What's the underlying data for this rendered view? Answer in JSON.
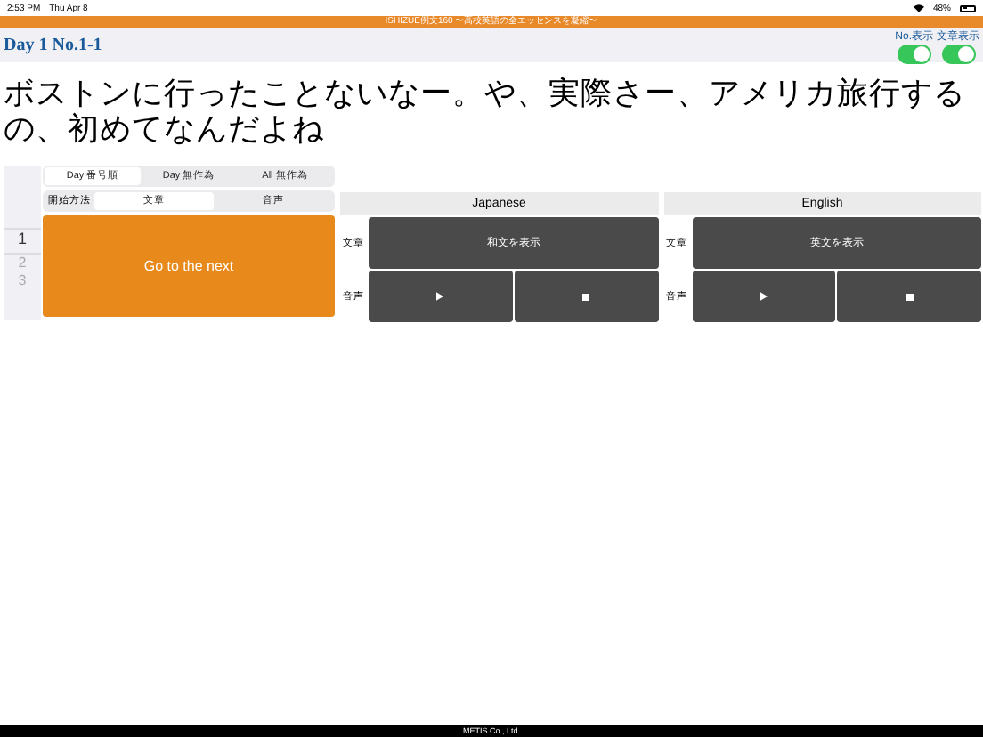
{
  "status_bar": {
    "time": "2:53 PM",
    "date": "Thu Apr 8",
    "battery": "48%"
  },
  "app_title": "ISHIZUE例文160 〜高校英語の全エッセンスを凝縮〜",
  "header": {
    "title": "Day 1  No.1-1",
    "toggles": [
      {
        "label": "No.表示",
        "on": true
      },
      {
        "label": "文章表示",
        "on": true
      }
    ]
  },
  "sentence": "ボストンに行ったことないなー。や、実際さー、アメリカ旅行するの、初めてなんだよね",
  "number_list": [
    {
      "label": "1",
      "selected": true
    },
    {
      "label": "2",
      "selected": false
    },
    {
      "label": "3",
      "selected": false
    }
  ],
  "order_tabs": [
    {
      "label": "Day 番号順",
      "selected": true
    },
    {
      "label": "Day 無作為",
      "selected": false
    },
    {
      "label": "All 無作為",
      "selected": false
    }
  ],
  "start_method": {
    "label": "開始方法",
    "options": [
      {
        "label": "文章",
        "selected": true
      },
      {
        "label": "音声",
        "selected": false
      }
    ]
  },
  "next_button": "Go to the next",
  "panels": [
    {
      "title": "Japanese",
      "text_label": "文章",
      "show_button": "和文を表示",
      "audio_label": "音声"
    },
    {
      "title": "English",
      "text_label": "文章",
      "show_button": "英文を表示",
      "audio_label": "音声"
    }
  ],
  "footer": "METIS Co., Ltd."
}
